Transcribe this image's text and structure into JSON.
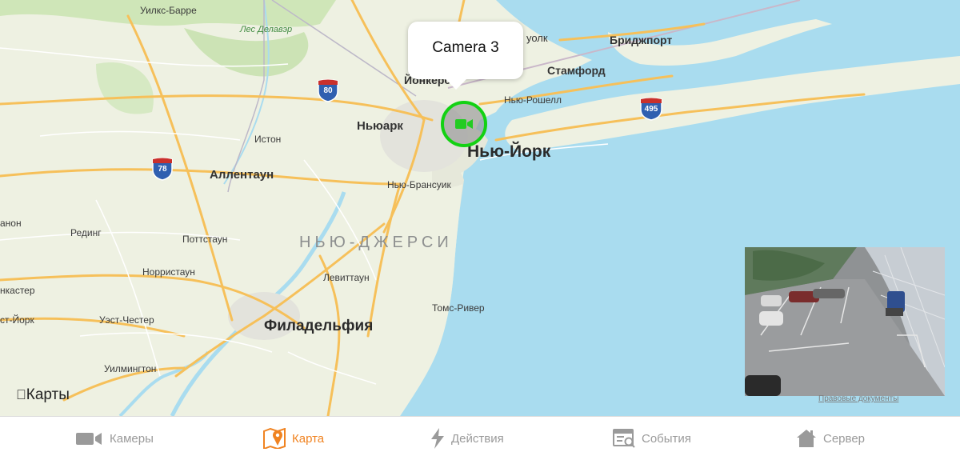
{
  "map": {
    "callout_title": "Camera 3",
    "attribution": "Карты",
    "legal_link": "Правовые документы",
    "labels": {
      "wilkes_barre": "Уилкс-Барре",
      "delaware_forest": "Лес Делавэр",
      "norwalk": "уолк",
      "bridgeport": "Бриджпорт",
      "stamford": "Стамфорд",
      "yonkers": "Йонкерс",
      "new_rochelle": "Нью-Рошелл",
      "newark": "Ньюарк",
      "new_york": "Нью-Йорк",
      "easton": "Истон",
      "allentown": "Аллентаун",
      "new_brunswick": "Нью-Брансуик",
      "lebanon": "анон",
      "reading": "Рединг",
      "pottstown": "Поттстаун",
      "new_jersey": "НЬЮ-ДЖЕРСИ",
      "norristown": "Норристаун",
      "levittown": "Левиттаун",
      "lancaster": "нкастер",
      "toms_river": "Томс-Ривер",
      "west_york": "ст-Йорк",
      "west_chester": "Уэст-Честер",
      "philadelphia": "Филадельфия",
      "wilmington": "Уилмингтон"
    },
    "highways": {
      "i80": "80",
      "i495": "495",
      "i78": "78"
    }
  },
  "tabs": [
    {
      "label": "Камеры",
      "icon": "video-camera-icon",
      "active": false
    },
    {
      "label": "Карта",
      "icon": "map-pin-icon",
      "active": true
    },
    {
      "label": "Действия",
      "icon": "lightning-icon",
      "active": false
    },
    {
      "label": "События",
      "icon": "event-log-icon",
      "active": false
    },
    {
      "label": "Сервер",
      "icon": "home-server-icon",
      "active": false
    }
  ],
  "colors": {
    "accent": "#f08321",
    "marker_ring": "#13d113",
    "water": "#a9dcef",
    "land": "#eef1e2",
    "road": "#f6c05a",
    "tab_inactive": "#9a9a9a"
  }
}
